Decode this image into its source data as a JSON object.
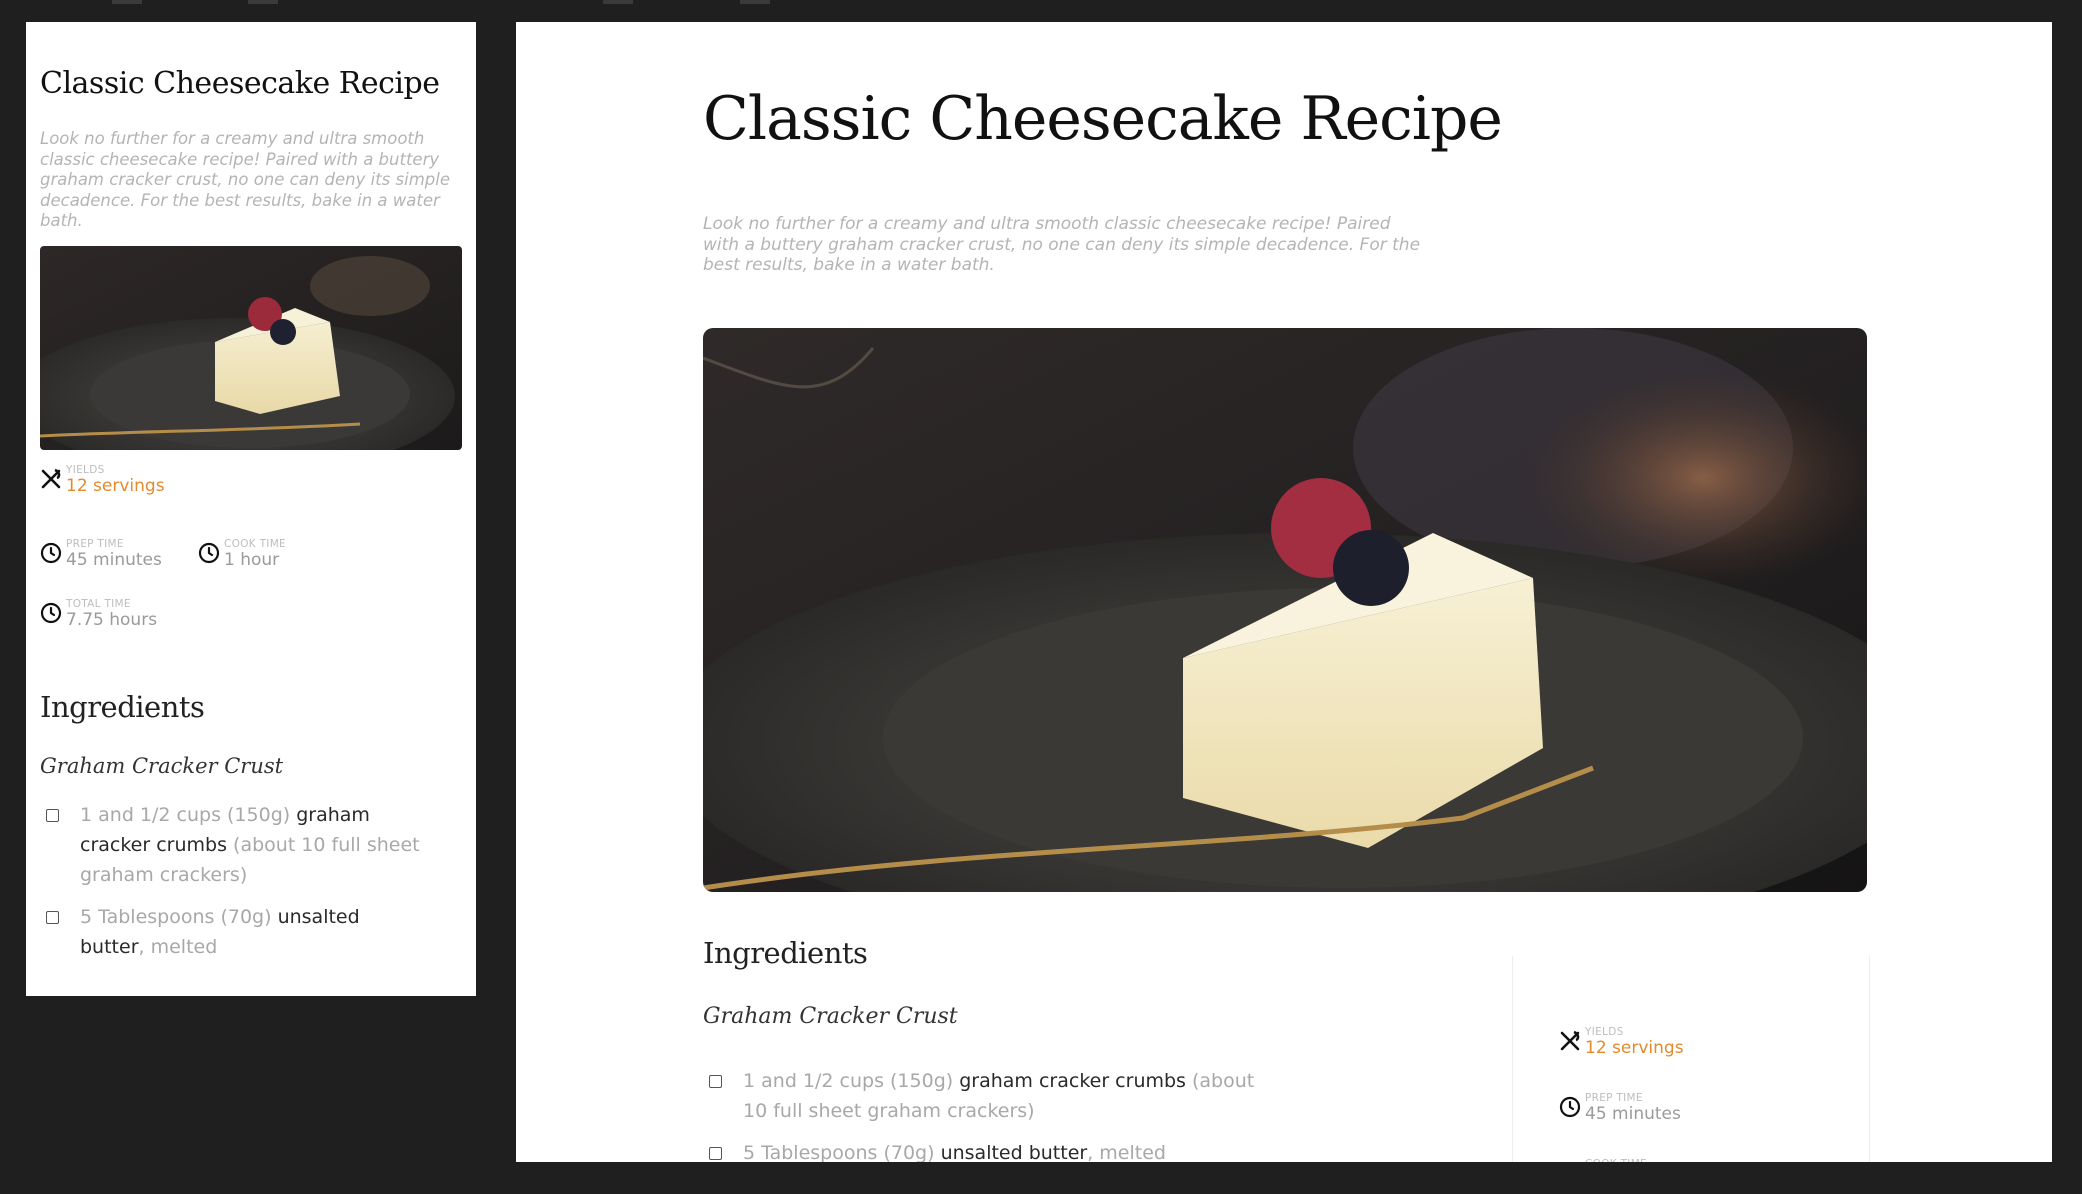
{
  "recipe": {
    "title": "Classic Cheesecake Recipe",
    "description": "Look no further for a creamy and ultra smooth classic cheesecake recipe! Paired with a buttery graham cracker crust, no one can deny its simple decadence. For the best results, bake in a water bath.",
    "image_alt": "cheesecake-slice-photo"
  },
  "meta": {
    "yields_label": "YIELDS",
    "yields_value": "12 servings",
    "prep_label": "PREP TIME",
    "prep_value": "45 minutes",
    "cook_label": "COOK TIME",
    "cook_value": "1 hour",
    "total_label": "TOTAL TIME",
    "total_value": "7.75 hours"
  },
  "ingredients": {
    "heading": "Ingredients",
    "group_title": "Graham Cracker Crust",
    "items": [
      {
        "qty": "1 and 1/2 cups (150g)",
        "name": "graham cracker crumbs",
        "note": "(about 10 full sheet graham crackers)"
      },
      {
        "qty": "5 Tablespoons (70g)",
        "name": "unsalted butter",
        "note": ", melted"
      }
    ]
  },
  "colors": {
    "accent": "#e58a2c",
    "background": "#1f1f1f",
    "page": "#ffffff"
  },
  "icons": {
    "yields": "fork-knife-icon",
    "time": "clock-icon"
  }
}
